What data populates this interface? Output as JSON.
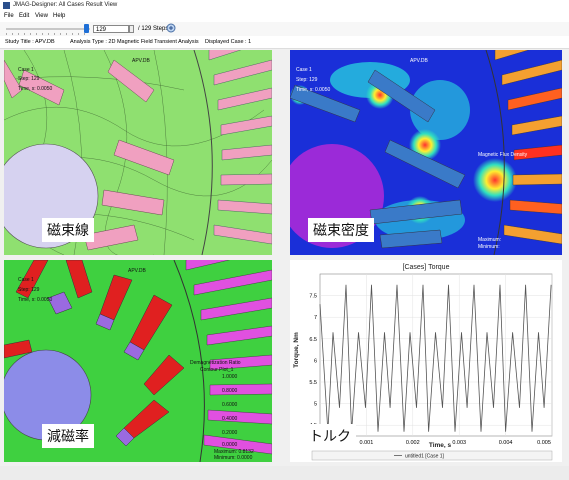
{
  "window": {
    "title": "JMAG-Designer: All Cases Result View"
  },
  "menu": {
    "file": "File",
    "edit": "Edit",
    "view": "View",
    "help": "Help"
  },
  "toolbar": {
    "step_value": "129",
    "steps_label": "/ 129 Steps",
    "slider_fraction": 1.0
  },
  "info": {
    "study_title": "Study Title : APV.DB",
    "analysis_type": "Analysis Type : 2D Magnetic Field Transient Analysis",
    "displayed_case": "Displayed Case : 1"
  },
  "panels": {
    "flux_lines": {
      "label": "磁束線",
      "name": "APV.DB",
      "case": "Case 1",
      "step": "Step: 129",
      "time": "Time, s: 0.0050"
    },
    "flux_density": {
      "label": "磁束密度",
      "name": "APV.DB",
      "case": "Case 1",
      "step": "Step: 129",
      "time": "Time, s: 0.0050",
      "legend_title": "Magnetic Flux Density",
      "maximum": "Maximum: ",
      "minimum": "Minimum: "
    },
    "demag": {
      "label": "減磁率",
      "name": "APV.DB",
      "case": "Case 1",
      "step": "Step: 129",
      "time": "Time, s: 0.0050",
      "legend_title": "Demagnetization Ratio",
      "contour": "Contour Plot_1",
      "levels": [
        "1.0000",
        "0.8000",
        "0.6000",
        "0.4000",
        "0.2000",
        "0.0000"
      ],
      "maximum": "Maximum: 0.8132",
      "minimum": "Minimum: 0.0000"
    },
    "torque": {
      "label": "トルク"
    }
  },
  "chart_data": {
    "type": "line",
    "title": "[Cases] Torque",
    "xlabel": "Time, s",
    "ylabel": "Torque, Nm",
    "xlim": [
      0,
      0.005
    ],
    "ylim": [
      4.25,
      8.0
    ],
    "xticks": [
      "0.001",
      "0.002",
      "0.003",
      "0.004",
      "0.005"
    ],
    "yticks": [
      "4.5",
      "5",
      "5.5",
      "6",
      "6.5",
      "7",
      "7.5"
    ],
    "grid": true,
    "legend_position": "bottom",
    "series": [
      {
        "name": "untitled1 [Case 1]",
        "color": "#555555",
        "x": [
          0,
          0.00017,
          0.00028,
          0.00042,
          0.00056,
          0.00068,
          0.00083,
          0.00098,
          0.00111,
          0.00125,
          0.00139,
          0.00151,
          0.00166,
          0.00181,
          0.00194,
          0.00208,
          0.00222,
          0.00234,
          0.00249,
          0.00264,
          0.00277,
          0.00291,
          0.00305,
          0.00317,
          0.00332,
          0.00347,
          0.0036,
          0.00374,
          0.00388,
          0.004,
          0.00415,
          0.0043,
          0.00443,
          0.00457,
          0.00471,
          0.00483,
          0.00498
        ],
        "values": [
          7.3,
          4.35,
          6.65,
          4.9,
          7.75,
          4.35,
          6.65,
          4.9,
          7.75,
          4.35,
          6.65,
          4.9,
          7.75,
          4.35,
          6.65,
          4.9,
          7.75,
          4.35,
          6.65,
          4.9,
          7.75,
          4.35,
          6.65,
          4.9,
          7.75,
          4.35,
          6.65,
          4.9,
          7.75,
          4.35,
          6.65,
          4.9,
          7.75,
          4.35,
          6.65,
          4.9,
          7.75
        ]
      }
    ]
  }
}
